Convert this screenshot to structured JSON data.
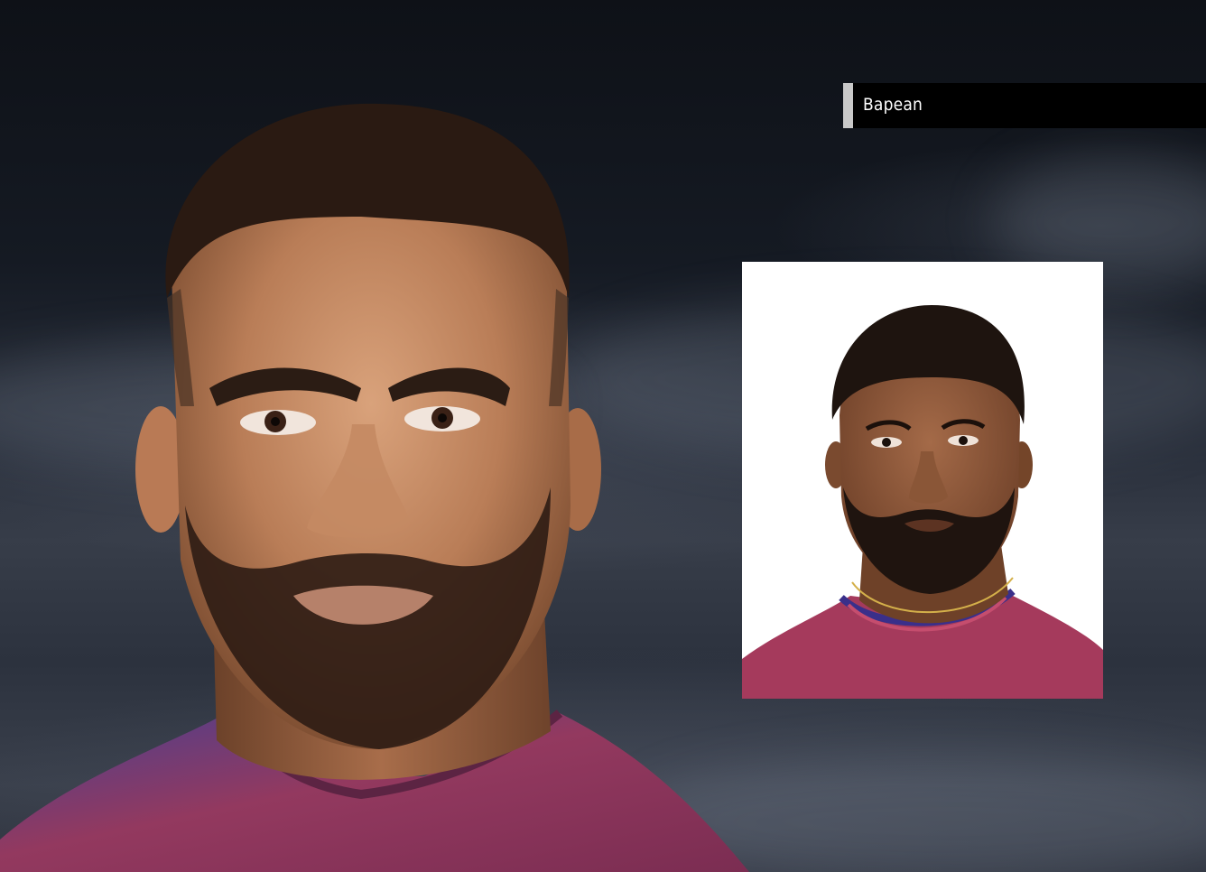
{
  "player": {
    "name": "Bapean"
  },
  "icons": {
    "banner_accent": "banner-accent-bar"
  },
  "colors": {
    "banner_background": "#000000",
    "banner_accent": "#c8c8c8",
    "banner_text": "#ffffff",
    "photo_background": "#ffffff",
    "jersey": "#a33a5c",
    "jersey_trim": "#3a2f8a"
  }
}
